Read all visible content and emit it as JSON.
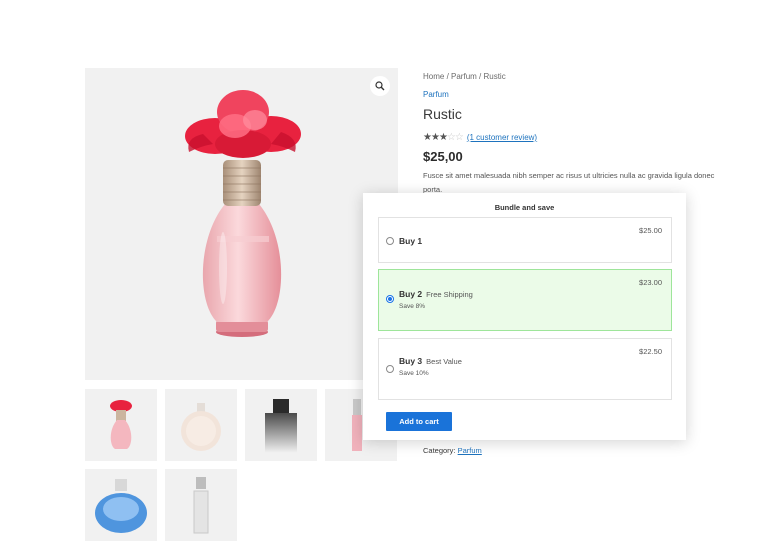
{
  "breadcrumb": {
    "home": "Home",
    "sep1": " / ",
    "category": "Parfum",
    "sep2": " / ",
    "current": "Rustic"
  },
  "product": {
    "category_link": "Parfum",
    "title": "Rustic",
    "rating": 3,
    "rating_max": 5,
    "review_link": "(1 customer review)",
    "price": "$25,00",
    "description": "Fusce sit amet malesuada nibh semper ac risus ut ultricies nulla ac gravida ligula donec porta.",
    "category_label": "Category:",
    "category_value": "Parfum"
  },
  "gallery": {
    "zoom_icon": "zoom-icon",
    "thumbnails": [
      "pink-rose-bottle",
      "round-flat-bottle",
      "dark-cap-gradient-bottle",
      "pink-slim-bottle",
      "blue-round-bottle",
      "clear-slim-bottle"
    ]
  },
  "bundle": {
    "title": "Bundle and save",
    "options": [
      {
        "label": "Buy 1",
        "tag": "",
        "save": "",
        "price": "$25.00",
        "selected": false
      },
      {
        "label": "Buy 2",
        "tag": "Free Shipping",
        "save": "Save 8%",
        "price": "$23.00",
        "selected": true
      },
      {
        "label": "Buy 3",
        "tag": "Best Value",
        "save": "Save 10%",
        "price": "$22.50",
        "selected": false
      }
    ],
    "add_to_cart": "Add to cart"
  },
  "colors": {
    "accent": "#1a73d9",
    "link": "#1e73be",
    "selected_bg": "#ebfbe8",
    "selected_border": "#9ee59a"
  }
}
